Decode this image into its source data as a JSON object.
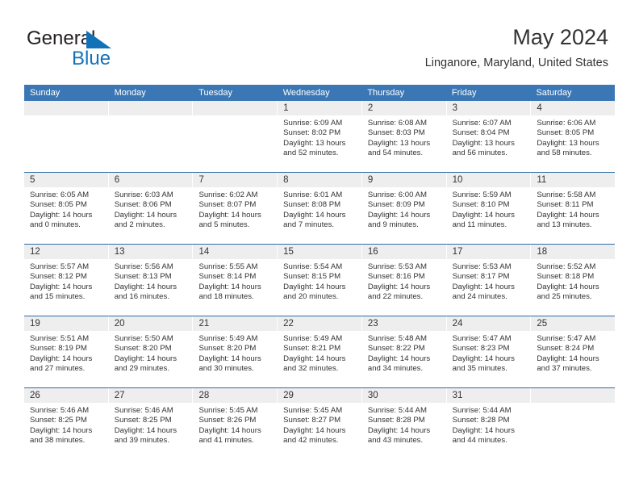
{
  "brand": {
    "name_part1": "General",
    "name_part2": "Blue",
    "triangle_icon": "blue-triangle-icon",
    "accent_color": "#1272b8"
  },
  "header": {
    "title": "May 2024",
    "location": "Linganore, Maryland, United States"
  },
  "theme": {
    "header_row_bg": "#3b77b5",
    "week_separator": "#2f6da8",
    "daynum_bg": "#eeeeee",
    "text_color": "#333333"
  },
  "columns": [
    "Sunday",
    "Monday",
    "Tuesday",
    "Wednesday",
    "Thursday",
    "Friday",
    "Saturday"
  ],
  "labels": {
    "sunrise_prefix": "Sunrise:",
    "sunset_prefix": "Sunset:",
    "daylight_prefix": "Daylight:"
  },
  "weeks": [
    [
      {
        "day": "",
        "empty": true,
        "line1": "",
        "line2": "",
        "line3": "",
        "line4": ""
      },
      {
        "day": "",
        "empty": true,
        "line1": "",
        "line2": "",
        "line3": "",
        "line4": ""
      },
      {
        "day": "",
        "empty": true,
        "line1": "",
        "line2": "",
        "line3": "",
        "line4": ""
      },
      {
        "day": "1",
        "sunrise": "6:09 AM",
        "sunset": "8:02 PM",
        "daylight": "13 hours and 52 minutes.",
        "line1": "Sunrise: 6:09 AM",
        "line2": "Sunset: 8:02 PM",
        "line3": "Daylight: 13 hours",
        "line4": "and 52 minutes."
      },
      {
        "day": "2",
        "sunrise": "6:08 AM",
        "sunset": "8:03 PM",
        "daylight": "13 hours and 54 minutes.",
        "line1": "Sunrise: 6:08 AM",
        "line2": "Sunset: 8:03 PM",
        "line3": "Daylight: 13 hours",
        "line4": "and 54 minutes."
      },
      {
        "day": "3",
        "sunrise": "6:07 AM",
        "sunset": "8:04 PM",
        "daylight": "13 hours and 56 minutes.",
        "line1": "Sunrise: 6:07 AM",
        "line2": "Sunset: 8:04 PM",
        "line3": "Daylight: 13 hours",
        "line4": "and 56 minutes."
      },
      {
        "day": "4",
        "sunrise": "6:06 AM",
        "sunset": "8:05 PM",
        "daylight": "13 hours and 58 minutes.",
        "line1": "Sunrise: 6:06 AM",
        "line2": "Sunset: 8:05 PM",
        "line3": "Daylight: 13 hours",
        "line4": "and 58 minutes."
      }
    ],
    [
      {
        "day": "5",
        "sunrise": "6:05 AM",
        "sunset": "8:05 PM",
        "daylight": "14 hours and 0 minutes.",
        "line1": "Sunrise: 6:05 AM",
        "line2": "Sunset: 8:05 PM",
        "line3": "Daylight: 14 hours",
        "line4": "and 0 minutes."
      },
      {
        "day": "6",
        "sunrise": "6:03 AM",
        "sunset": "8:06 PM",
        "daylight": "14 hours and 2 minutes.",
        "line1": "Sunrise: 6:03 AM",
        "line2": "Sunset: 8:06 PM",
        "line3": "Daylight: 14 hours",
        "line4": "and 2 minutes."
      },
      {
        "day": "7",
        "sunrise": "6:02 AM",
        "sunset": "8:07 PM",
        "daylight": "14 hours and 5 minutes.",
        "line1": "Sunrise: 6:02 AM",
        "line2": "Sunset: 8:07 PM",
        "line3": "Daylight: 14 hours",
        "line4": "and 5 minutes."
      },
      {
        "day": "8",
        "sunrise": "6:01 AM",
        "sunset": "8:08 PM",
        "daylight": "14 hours and 7 minutes.",
        "line1": "Sunrise: 6:01 AM",
        "line2": "Sunset: 8:08 PM",
        "line3": "Daylight: 14 hours",
        "line4": "and 7 minutes."
      },
      {
        "day": "9",
        "sunrise": "6:00 AM",
        "sunset": "8:09 PM",
        "daylight": "14 hours and 9 minutes.",
        "line1": "Sunrise: 6:00 AM",
        "line2": "Sunset: 8:09 PM",
        "line3": "Daylight: 14 hours",
        "line4": "and 9 minutes."
      },
      {
        "day": "10",
        "sunrise": "5:59 AM",
        "sunset": "8:10 PM",
        "daylight": "14 hours and 11 minutes.",
        "line1": "Sunrise: 5:59 AM",
        "line2": "Sunset: 8:10 PM",
        "line3": "Daylight: 14 hours",
        "line4": "and 11 minutes."
      },
      {
        "day": "11",
        "sunrise": "5:58 AM",
        "sunset": "8:11 PM",
        "daylight": "14 hours and 13 minutes.",
        "line1": "Sunrise: 5:58 AM",
        "line2": "Sunset: 8:11 PM",
        "line3": "Daylight: 14 hours",
        "line4": "and 13 minutes."
      }
    ],
    [
      {
        "day": "12",
        "sunrise": "5:57 AM",
        "sunset": "8:12 PM",
        "daylight": "14 hours and 15 minutes.",
        "line1": "Sunrise: 5:57 AM",
        "line2": "Sunset: 8:12 PM",
        "line3": "Daylight: 14 hours",
        "line4": "and 15 minutes."
      },
      {
        "day": "13",
        "sunrise": "5:56 AM",
        "sunset": "8:13 PM",
        "daylight": "14 hours and 16 minutes.",
        "line1": "Sunrise: 5:56 AM",
        "line2": "Sunset: 8:13 PM",
        "line3": "Daylight: 14 hours",
        "line4": "and 16 minutes."
      },
      {
        "day": "14",
        "sunrise": "5:55 AM",
        "sunset": "8:14 PM",
        "daylight": "14 hours and 18 minutes.",
        "line1": "Sunrise: 5:55 AM",
        "line2": "Sunset: 8:14 PM",
        "line3": "Daylight: 14 hours",
        "line4": "and 18 minutes."
      },
      {
        "day": "15",
        "sunrise": "5:54 AM",
        "sunset": "8:15 PM",
        "daylight": "14 hours and 20 minutes.",
        "line1": "Sunrise: 5:54 AM",
        "line2": "Sunset: 8:15 PM",
        "line3": "Daylight: 14 hours",
        "line4": "and 20 minutes."
      },
      {
        "day": "16",
        "sunrise": "5:53 AM",
        "sunset": "8:16 PM",
        "daylight": "14 hours and 22 minutes.",
        "line1": "Sunrise: 5:53 AM",
        "line2": "Sunset: 8:16 PM",
        "line3": "Daylight: 14 hours",
        "line4": "and 22 minutes."
      },
      {
        "day": "17",
        "sunrise": "5:53 AM",
        "sunset": "8:17 PM",
        "daylight": "14 hours and 24 minutes.",
        "line1": "Sunrise: 5:53 AM",
        "line2": "Sunset: 8:17 PM",
        "line3": "Daylight: 14 hours",
        "line4": "and 24 minutes."
      },
      {
        "day": "18",
        "sunrise": "5:52 AM",
        "sunset": "8:18 PM",
        "daylight": "14 hours and 25 minutes.",
        "line1": "Sunrise: 5:52 AM",
        "line2": "Sunset: 8:18 PM",
        "line3": "Daylight: 14 hours",
        "line4": "and 25 minutes."
      }
    ],
    [
      {
        "day": "19",
        "sunrise": "5:51 AM",
        "sunset": "8:19 PM",
        "daylight": "14 hours and 27 minutes.",
        "line1": "Sunrise: 5:51 AM",
        "line2": "Sunset: 8:19 PM",
        "line3": "Daylight: 14 hours",
        "line4": "and 27 minutes."
      },
      {
        "day": "20",
        "sunrise": "5:50 AM",
        "sunset": "8:20 PM",
        "daylight": "14 hours and 29 minutes.",
        "line1": "Sunrise: 5:50 AM",
        "line2": "Sunset: 8:20 PM",
        "line3": "Daylight: 14 hours",
        "line4": "and 29 minutes."
      },
      {
        "day": "21",
        "sunrise": "5:49 AM",
        "sunset": "8:20 PM",
        "daylight": "14 hours and 30 minutes.",
        "line1": "Sunrise: 5:49 AM",
        "line2": "Sunset: 8:20 PM",
        "line3": "Daylight: 14 hours",
        "line4": "and 30 minutes."
      },
      {
        "day": "22",
        "sunrise": "5:49 AM",
        "sunset": "8:21 PM",
        "daylight": "14 hours and 32 minutes.",
        "line1": "Sunrise: 5:49 AM",
        "line2": "Sunset: 8:21 PM",
        "line3": "Daylight: 14 hours",
        "line4": "and 32 minutes."
      },
      {
        "day": "23",
        "sunrise": "5:48 AM",
        "sunset": "8:22 PM",
        "daylight": "14 hours and 34 minutes.",
        "line1": "Sunrise: 5:48 AM",
        "line2": "Sunset: 8:22 PM",
        "line3": "Daylight: 14 hours",
        "line4": "and 34 minutes."
      },
      {
        "day": "24",
        "sunrise": "5:47 AM",
        "sunset": "8:23 PM",
        "daylight": "14 hours and 35 minutes.",
        "line1": "Sunrise: 5:47 AM",
        "line2": "Sunset: 8:23 PM",
        "line3": "Daylight: 14 hours",
        "line4": "and 35 minutes."
      },
      {
        "day": "25",
        "sunrise": "5:47 AM",
        "sunset": "8:24 PM",
        "daylight": "14 hours and 37 minutes.",
        "line1": "Sunrise: 5:47 AM",
        "line2": "Sunset: 8:24 PM",
        "line3": "Daylight: 14 hours",
        "line4": "and 37 minutes."
      }
    ],
    [
      {
        "day": "26",
        "sunrise": "5:46 AM",
        "sunset": "8:25 PM",
        "daylight": "14 hours and 38 minutes.",
        "line1": "Sunrise: 5:46 AM",
        "line2": "Sunset: 8:25 PM",
        "line3": "Daylight: 14 hours",
        "line4": "and 38 minutes."
      },
      {
        "day": "27",
        "sunrise": "5:46 AM",
        "sunset": "8:25 PM",
        "daylight": "14 hours and 39 minutes.",
        "line1": "Sunrise: 5:46 AM",
        "line2": "Sunset: 8:25 PM",
        "line3": "Daylight: 14 hours",
        "line4": "and 39 minutes."
      },
      {
        "day": "28",
        "sunrise": "5:45 AM",
        "sunset": "8:26 PM",
        "daylight": "14 hours and 41 minutes.",
        "line1": "Sunrise: 5:45 AM",
        "line2": "Sunset: 8:26 PM",
        "line3": "Daylight: 14 hours",
        "line4": "and 41 minutes."
      },
      {
        "day": "29",
        "sunrise": "5:45 AM",
        "sunset": "8:27 PM",
        "daylight": "14 hours and 42 minutes.",
        "line1": "Sunrise: 5:45 AM",
        "line2": "Sunset: 8:27 PM",
        "line3": "Daylight: 14 hours",
        "line4": "and 42 minutes."
      },
      {
        "day": "30",
        "sunrise": "5:44 AM",
        "sunset": "8:28 PM",
        "daylight": "14 hours and 43 minutes.",
        "line1": "Sunrise: 5:44 AM",
        "line2": "Sunset: 8:28 PM",
        "line3": "Daylight: 14 hours",
        "line4": "and 43 minutes."
      },
      {
        "day": "31",
        "sunrise": "5:44 AM",
        "sunset": "8:28 PM",
        "daylight": "14 hours and 44 minutes.",
        "line1": "Sunrise: 5:44 AM",
        "line2": "Sunset: 8:28 PM",
        "line3": "Daylight: 14 hours",
        "line4": "and 44 minutes."
      },
      {
        "day": "",
        "empty": true,
        "line1": "",
        "line2": "",
        "line3": "",
        "line4": ""
      }
    ]
  ]
}
